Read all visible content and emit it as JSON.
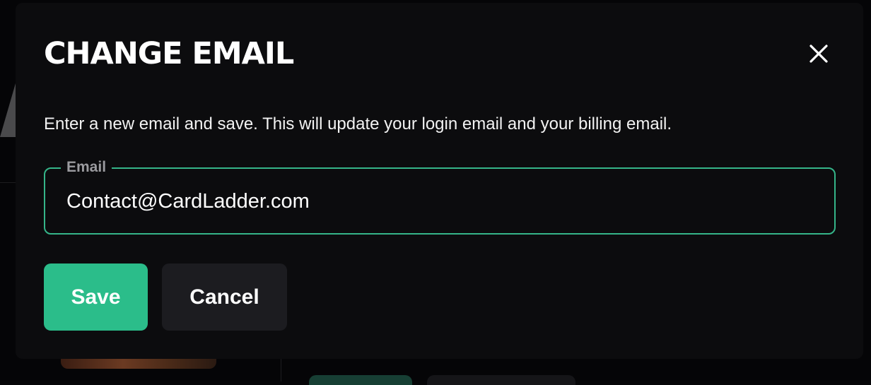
{
  "modal": {
    "title": "CHANGE EMAIL",
    "description": "Enter a new email and save. This will update your login email and your billing email.",
    "close_icon": "close-icon"
  },
  "email_field": {
    "label": "Email",
    "value": "Contact@CardLadder.com",
    "placeholder": ""
  },
  "actions": {
    "save_label": "Save",
    "cancel_label": "Cancel"
  },
  "colors": {
    "accent": "#2bbd8a",
    "field_border": "#35b589",
    "modal_bg": "#0c0c0e",
    "cancel_bg": "#1c1c20"
  }
}
